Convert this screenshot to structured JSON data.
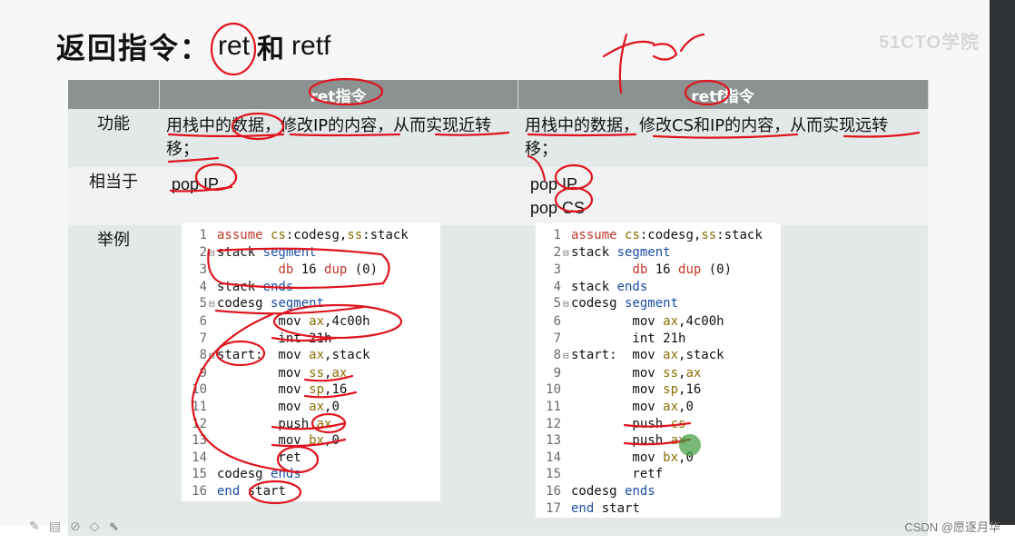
{
  "title": {
    "prefix": "返回指令：",
    "ret": "ret",
    "and": "和",
    "retf": "retf"
  },
  "watermark": "51CTO学院",
  "handwriting": {
    "far": "far"
  },
  "footer": {
    "credit": "CSDN @愿逐月华"
  },
  "table": {
    "headers": [
      "",
      "ret指令",
      "retf指令"
    ],
    "rows": [
      {
        "label": "功能",
        "ret": "用栈中的数据，修改IP的内容，从而实现近转移；",
        "retf": "用栈中的数据，修改CS和IP的内容，从而实现远转移；"
      },
      {
        "label": "相当于",
        "ret_lines": [
          "pop IP"
        ],
        "retf_lines": [
          "pop IP",
          "pop CS"
        ]
      },
      {
        "label": "举例"
      }
    ]
  },
  "code_ret": [
    [
      "1",
      "",
      "assume cs:codesg,ss:stack"
    ],
    [
      "2",
      "⊟",
      "stack segment"
    ],
    [
      "3",
      "",
      "        db 16 dup (0)"
    ],
    [
      "4",
      "",
      "stack ends"
    ],
    [
      "5",
      "⊟",
      "codesg segment"
    ],
    [
      "6",
      "",
      "        mov ax,4c00h"
    ],
    [
      "7",
      "",
      "        int 21h"
    ],
    [
      "8",
      "⊟",
      "start:  mov ax,stack"
    ],
    [
      "9",
      "",
      "        mov ss,ax"
    ],
    [
      "10",
      "",
      "        mov sp,16"
    ],
    [
      "11",
      "",
      "        mov ax,0"
    ],
    [
      "12",
      "",
      "        push ax"
    ],
    [
      "13",
      "",
      "        mov bx,0"
    ],
    [
      "14",
      "",
      "        ret"
    ],
    [
      "15",
      "",
      "codesg ends"
    ],
    [
      "16",
      "",
      "end start"
    ]
  ],
  "code_retf": [
    [
      "1",
      "",
      "assume cs:codesg,ss:stack"
    ],
    [
      "2",
      "⊟",
      "stack segment"
    ],
    [
      "3",
      "",
      "        db 16 dup (0)"
    ],
    [
      "4",
      "",
      "stack ends"
    ],
    [
      "5",
      "⊟",
      "codesg segment"
    ],
    [
      "6",
      "",
      "        mov ax,4c00h"
    ],
    [
      "7",
      "",
      "        int 21h"
    ],
    [
      "8",
      "⊟",
      "start:  mov ax,stack"
    ],
    [
      "9",
      "",
      "        mov ss,ax"
    ],
    [
      "10",
      "",
      "        mov sp,16"
    ],
    [
      "11",
      "",
      "        mov ax,0"
    ],
    [
      "12",
      "",
      "        push cs"
    ],
    [
      "13",
      "",
      "        push ax"
    ],
    [
      "14",
      "",
      "        mov bx,0"
    ],
    [
      "15",
      "",
      "        retf"
    ],
    [
      "16",
      "",
      "codesg ends"
    ],
    [
      "17",
      "",
      "end start"
    ]
  ],
  "colors": {
    "header_bg": "#8c9192",
    "row_bg": "#e3e8e8",
    "annotation_red": "#e0141e",
    "pointer_green": "#3c9a3c"
  },
  "toolbar_icons": [
    "pen-icon",
    "slides-icon",
    "eraser-icon",
    "highlighter-icon",
    "pointer-icon"
  ]
}
